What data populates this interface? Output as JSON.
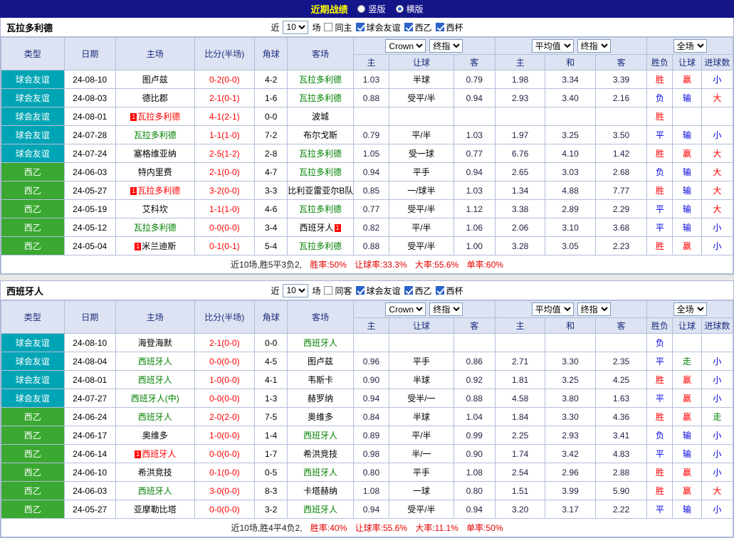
{
  "top_bar": {
    "title": "近期战绩",
    "layout_options": [
      {
        "label": "竖版",
        "selected": false
      },
      {
        "label": "横版",
        "selected": true
      }
    ]
  },
  "colors": {
    "topbar_bg": "#15158a",
    "header_bg": "#dde3f2",
    "type_friendly": "#00a5b5",
    "type_league": "#3aa831",
    "focal": "#008000",
    "black": "#000000",
    "red": "#ff0000",
    "blue": "#0000dd",
    "green": "#008000",
    "score": "#ff0000",
    "odds": "#222244",
    "badge_bg": "#ff0000"
  },
  "sections": [
    {
      "team": "瓦拉多利德",
      "filter": {
        "prefix": "近",
        "count": "10",
        "suffix": "场",
        "venue": {
          "label": "同主",
          "checked": false
        },
        "comps": [
          {
            "label": "球会友谊",
            "checked": true
          },
          {
            "label": "西乙",
            "checked": true
          },
          {
            "label": "西杯",
            "checked": true
          }
        ]
      },
      "header": {
        "base_cols": [
          "类型",
          "日期",
          "主场",
          "比分(半场)",
          "角球",
          "客场"
        ],
        "asia_selects": [
          "Crown",
          "终指"
        ],
        "asia_cols": [
          "主",
          "让球",
          "客"
        ],
        "euro_selects": [
          "平均值",
          "终指"
        ],
        "euro_cols": [
          "主",
          "和",
          "客"
        ],
        "scope_select": "全场",
        "result_cols": [
          "胜负",
          "让球",
          "进球数"
        ]
      },
      "rows": [
        {
          "type": "球会友谊",
          "type_color": "type_friendly",
          "date": "24-08-10",
          "home": {
            "name": "图卢兹",
            "color": "black"
          },
          "score": "0-2(0-0)",
          "corners": "4-2",
          "away": {
            "name": "瓦拉多利德",
            "color": "focal"
          },
          "asia": [
            "1.03",
            "半球",
            "0.79"
          ],
          "euro": [
            "1.98",
            "3.34",
            "3.39"
          ],
          "result": {
            "text": "胜",
            "color": "red"
          },
          "handicap": {
            "text": "赢",
            "color": "red"
          },
          "goals": {
            "text": "小",
            "color": "blue"
          }
        },
        {
          "type": "球会友谊",
          "type_color": "type_friendly",
          "date": "24-08-03",
          "home": {
            "name": "德比郡",
            "color": "black"
          },
          "score": "2-1(0-1)",
          "corners": "1-6",
          "away": {
            "name": "瓦拉多利德",
            "color": "focal"
          },
          "asia": [
            "0.88",
            "受平/半",
            "0.94"
          ],
          "euro": [
            "2.93",
            "3.40",
            "2.16"
          ],
          "result": {
            "text": "负",
            "color": "blue"
          },
          "handicap": {
            "text": "输",
            "color": "blue"
          },
          "goals": {
            "text": "大",
            "color": "red"
          }
        },
        {
          "type": "球会友谊",
          "type_color": "type_friendly",
          "date": "24-08-01",
          "home": {
            "name": "瓦拉多利德",
            "color": "red",
            "badge": "1",
            "badge_pos": "before"
          },
          "score": "4-1(2-1)",
          "corners": "0-0",
          "away": {
            "name": "波城",
            "color": "black"
          },
          "asia": [
            "",
            "",
            ""
          ],
          "euro": [
            "",
            "",
            ""
          ],
          "result": {
            "text": "胜",
            "color": "red"
          },
          "handicap": {
            "text": "",
            "color": "black"
          },
          "goals": {
            "text": "",
            "color": "black"
          }
        },
        {
          "type": "球会友谊",
          "type_color": "type_friendly",
          "date": "24-07-28",
          "home": {
            "name": "瓦拉多利德",
            "color": "focal"
          },
          "score": "1-1(1-0)",
          "corners": "7-2",
          "away": {
            "name": "布尔戈斯",
            "color": "black"
          },
          "asia": [
            "0.79",
            "平/半",
            "1.03"
          ],
          "euro": [
            "1.97",
            "3.25",
            "3.50"
          ],
          "result": {
            "text": "平",
            "color": "blue"
          },
          "handicap": {
            "text": "输",
            "color": "blue"
          },
          "goals": {
            "text": "小",
            "color": "blue"
          }
        },
        {
          "type": "球会友谊",
          "type_color": "type_friendly",
          "date": "24-07-24",
          "home": {
            "name": "塞格维亚纳",
            "color": "black"
          },
          "score": "2-5(1-2)",
          "corners": "2-8",
          "away": {
            "name": "瓦拉多利德",
            "color": "focal"
          },
          "asia": [
            "1.05",
            "受一球",
            "0.77"
          ],
          "euro": [
            "6.76",
            "4.10",
            "1.42"
          ],
          "result": {
            "text": "胜",
            "color": "red"
          },
          "handicap": {
            "text": "赢",
            "color": "red"
          },
          "goals": {
            "text": "大",
            "color": "red"
          }
        },
        {
          "type": "西乙",
          "type_color": "type_league",
          "date": "24-06-03",
          "home": {
            "name": "特内里费",
            "color": "black"
          },
          "score": "2-1(0-0)",
          "corners": "4-7",
          "away": {
            "name": "瓦拉多利德",
            "color": "focal"
          },
          "asia": [
            "0.94",
            "平手",
            "0.94"
          ],
          "euro": [
            "2.65",
            "3.03",
            "2.68"
          ],
          "result": {
            "text": "负",
            "color": "blue"
          },
          "handicap": {
            "text": "输",
            "color": "blue"
          },
          "goals": {
            "text": "大",
            "color": "red"
          }
        },
        {
          "type": "西乙",
          "type_color": "type_league",
          "date": "24-05-27",
          "home": {
            "name": "瓦拉多利德",
            "color": "red",
            "badge": "1",
            "badge_pos": "before"
          },
          "score": "3-2(0-0)",
          "corners": "3-3",
          "away": {
            "name": "比利亚雷亚尔B队",
            "color": "black"
          },
          "asia": [
            "0.85",
            "一/球半",
            "1.03"
          ],
          "euro": [
            "1.34",
            "4.88",
            "7.77"
          ],
          "result": {
            "text": "胜",
            "color": "red"
          },
          "handicap": {
            "text": "输",
            "color": "blue"
          },
          "goals": {
            "text": "大",
            "color": "red"
          }
        },
        {
          "type": "西乙",
          "type_color": "type_league",
          "date": "24-05-19",
          "home": {
            "name": "艾科坎",
            "color": "black"
          },
          "score": "1-1(1-0)",
          "corners": "4-6",
          "away": {
            "name": "瓦拉多利德",
            "color": "focal"
          },
          "asia": [
            "0.77",
            "受平/半",
            "1.12"
          ],
          "euro": [
            "3.38",
            "2.89",
            "2.29"
          ],
          "result": {
            "text": "平",
            "color": "blue"
          },
          "handicap": {
            "text": "输",
            "color": "blue"
          },
          "goals": {
            "text": "大",
            "color": "red"
          }
        },
        {
          "type": "西乙",
          "type_color": "type_league",
          "date": "24-05-12",
          "home": {
            "name": "瓦拉多利德",
            "color": "focal"
          },
          "score": "0-0(0-0)",
          "corners": "3-4",
          "away": {
            "name": "西班牙人",
            "color": "black",
            "badge": "1",
            "badge_pos": "after"
          },
          "asia": [
            "0.82",
            "平/半",
            "1.06"
          ],
          "euro": [
            "2.06",
            "3.10",
            "3.68"
          ],
          "result": {
            "text": "平",
            "color": "blue"
          },
          "handicap": {
            "text": "输",
            "color": "blue"
          },
          "goals": {
            "text": "小",
            "color": "blue"
          }
        },
        {
          "type": "西乙",
          "type_color": "type_league",
          "date": "24-05-04",
          "home": {
            "name": "米兰迪斯",
            "color": "black",
            "badge": "1",
            "badge_pos": "before"
          },
          "score": "0-1(0-1)",
          "corners": "5-4",
          "away": {
            "name": "瓦拉多利德",
            "color": "focal"
          },
          "asia": [
            "0.88",
            "受平/半",
            "1.00"
          ],
          "euro": [
            "3.28",
            "3.05",
            "2.23"
          ],
          "result": {
            "text": "胜",
            "color": "red"
          },
          "handicap": {
            "text": "赢",
            "color": "red"
          },
          "goals": {
            "text": "小",
            "color": "blue"
          }
        }
      ],
      "summary": {
        "prefix": "近10场,胜5平3负2,",
        "stats": [
          {
            "label": "胜率:",
            "value": "50%"
          },
          {
            "label": "让球率:",
            "value": "33.3%"
          },
          {
            "label": "大率:",
            "value": "55.6%"
          },
          {
            "label": "单率:",
            "value": "60%"
          }
        ]
      }
    },
    {
      "team": "西班牙人",
      "filter": {
        "prefix": "近",
        "count": "10",
        "suffix": "场",
        "venue": {
          "label": "同客",
          "checked": false
        },
        "comps": [
          {
            "label": "球会友谊",
            "checked": true
          },
          {
            "label": "西乙",
            "checked": true
          },
          {
            "label": "西杯",
            "checked": true
          }
        ]
      },
      "header": {
        "base_cols": [
          "类型",
          "日期",
          "主场",
          "比分(半场)",
          "角球",
          "客场"
        ],
        "asia_selects": [
          "Crown",
          "终指"
        ],
        "asia_cols": [
          "主",
          "让球",
          "客"
        ],
        "euro_selects": [
          "平均值",
          "终指"
        ],
        "euro_cols": [
          "主",
          "和",
          "客"
        ],
        "scope_select": "全场",
        "result_cols": [
          "胜负",
          "让球",
          "进球数"
        ]
      },
      "rows": [
        {
          "type": "球会友谊",
          "type_color": "type_friendly",
          "date": "24-08-10",
          "home": {
            "name": "海登海默",
            "color": "black"
          },
          "score": "2-1(0-0)",
          "corners": "0-0",
          "away": {
            "name": "西班牙人",
            "color": "focal"
          },
          "asia": [
            "",
            "",
            ""
          ],
          "euro": [
            "",
            "",
            ""
          ],
          "result": {
            "text": "负",
            "color": "blue"
          },
          "handicap": {
            "text": "",
            "color": "black"
          },
          "goals": {
            "text": "",
            "color": "black"
          }
        },
        {
          "type": "球会友谊",
          "type_color": "type_friendly",
          "date": "24-08-04",
          "home": {
            "name": "西班牙人",
            "color": "focal"
          },
          "score": "0-0(0-0)",
          "corners": "4-5",
          "away": {
            "name": "图卢兹",
            "color": "black"
          },
          "asia": [
            "0.96",
            "平手",
            "0.86"
          ],
          "euro": [
            "2.71",
            "3.30",
            "2.35"
          ],
          "result": {
            "text": "平",
            "color": "blue"
          },
          "handicap": {
            "text": "走",
            "color": "green"
          },
          "goals": {
            "text": "小",
            "color": "blue"
          }
        },
        {
          "type": "球会友谊",
          "type_color": "type_friendly",
          "date": "24-08-01",
          "home": {
            "name": "西班牙人",
            "color": "focal"
          },
          "score": "1-0(0-0)",
          "corners": "4-1",
          "away": {
            "name": "韦斯卡",
            "color": "black"
          },
          "asia": [
            "0.90",
            "半球",
            "0.92"
          ],
          "euro": [
            "1.81",
            "3.25",
            "4.25"
          ],
          "result": {
            "text": "胜",
            "color": "red"
          },
          "handicap": {
            "text": "赢",
            "color": "red"
          },
          "goals": {
            "text": "小",
            "color": "blue"
          }
        },
        {
          "type": "球会友谊",
          "type_color": "type_friendly",
          "date": "24-07-27",
          "home": {
            "name": "西班牙人(中)",
            "color": "focal"
          },
          "score": "0-0(0-0)",
          "corners": "1-3",
          "away": {
            "name": "赫罗纳",
            "color": "black"
          },
          "asia": [
            "0.94",
            "受半/一",
            "0.88"
          ],
          "euro": [
            "4.58",
            "3.80",
            "1.63"
          ],
          "result": {
            "text": "平",
            "color": "blue"
          },
          "handicap": {
            "text": "赢",
            "color": "red"
          },
          "goals": {
            "text": "小",
            "color": "blue"
          }
        },
        {
          "type": "西乙",
          "type_color": "type_league",
          "date": "24-06-24",
          "home": {
            "name": "西班牙人",
            "color": "focal"
          },
          "score": "2-0(2-0)",
          "corners": "7-5",
          "away": {
            "name": "奥维多",
            "color": "black"
          },
          "asia": [
            "0.84",
            "半球",
            "1.04"
          ],
          "euro": [
            "1.84",
            "3.30",
            "4.36"
          ],
          "result": {
            "text": "胜",
            "color": "red"
          },
          "handicap": {
            "text": "赢",
            "color": "red"
          },
          "goals": {
            "text": "走",
            "color": "green"
          }
        },
        {
          "type": "西乙",
          "type_color": "type_league",
          "date": "24-06-17",
          "home": {
            "name": "奥维多",
            "color": "black"
          },
          "score": "1-0(0-0)",
          "corners": "1-4",
          "away": {
            "name": "西班牙人",
            "color": "focal"
          },
          "asia": [
            "0.89",
            "平/半",
            "0.99"
          ],
          "euro": [
            "2.25",
            "2.93",
            "3.41"
          ],
          "result": {
            "text": "负",
            "color": "blue"
          },
          "handicap": {
            "text": "输",
            "color": "blue"
          },
          "goals": {
            "text": "小",
            "color": "blue"
          }
        },
        {
          "type": "西乙",
          "type_color": "type_league",
          "date": "24-06-14",
          "home": {
            "name": "西班牙人",
            "color": "red",
            "badge": "1",
            "badge_pos": "before"
          },
          "score": "0-0(0-0)",
          "corners": "1-7",
          "away": {
            "name": "希洪竞技",
            "color": "black"
          },
          "asia": [
            "0.98",
            "半/一",
            "0.90"
          ],
          "euro": [
            "1.74",
            "3.42",
            "4.83"
          ],
          "result": {
            "text": "平",
            "color": "blue"
          },
          "handicap": {
            "text": "输",
            "color": "blue"
          },
          "goals": {
            "text": "小",
            "color": "blue"
          }
        },
        {
          "type": "西乙",
          "type_color": "type_league",
          "date": "24-06-10",
          "home": {
            "name": "希洪竞技",
            "color": "black"
          },
          "score": "0-1(0-0)",
          "corners": "0-5",
          "away": {
            "name": "西班牙人",
            "color": "focal"
          },
          "asia": [
            "0.80",
            "平手",
            "1.08"
          ],
          "euro": [
            "2.54",
            "2.96",
            "2.88"
          ],
          "result": {
            "text": "胜",
            "color": "red"
          },
          "handicap": {
            "text": "赢",
            "color": "red"
          },
          "goals": {
            "text": "小",
            "color": "blue"
          }
        },
        {
          "type": "西乙",
          "type_color": "type_league",
          "date": "24-06-03",
          "home": {
            "name": "西班牙人",
            "color": "focal"
          },
          "score": "3-0(0-0)",
          "corners": "8-3",
          "away": {
            "name": "卡塔赫纳",
            "color": "black"
          },
          "asia": [
            "1.08",
            "一球",
            "0.80"
          ],
          "euro": [
            "1.51",
            "3.99",
            "5.90"
          ],
          "result": {
            "text": "胜",
            "color": "red"
          },
          "handicap": {
            "text": "赢",
            "color": "red"
          },
          "goals": {
            "text": "大",
            "color": "red"
          }
        },
        {
          "type": "西乙",
          "type_color": "type_league",
          "date": "24-05-27",
          "home": {
            "name": "亚摩勒比塔",
            "color": "black"
          },
          "score": "0-0(0-0)",
          "corners": "3-2",
          "away": {
            "name": "西班牙人",
            "color": "focal"
          },
          "asia": [
            "0.94",
            "受平/半",
            "0.94"
          ],
          "euro": [
            "3.20",
            "3.17",
            "2.22"
          ],
          "result": {
            "text": "平",
            "color": "blue"
          },
          "handicap": {
            "text": "输",
            "color": "blue"
          },
          "goals": {
            "text": "小",
            "color": "blue"
          }
        }
      ],
      "summary": {
        "prefix": "近10场,胜4平4负2,",
        "stats": [
          {
            "label": "胜率:",
            "value": "40%"
          },
          {
            "label": "让球率:",
            "value": "55.6%"
          },
          {
            "label": "大率:",
            "value": "11.1%"
          },
          {
            "label": "单率:",
            "value": "50%"
          }
        ]
      }
    }
  ]
}
